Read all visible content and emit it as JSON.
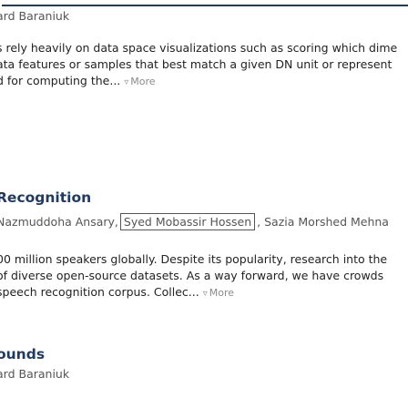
{
  "entry1": {
    "authors": "ard Baraniuk",
    "abstract_lines": [
      "s rely heavily on data space visualizations such as scoring which dime",
      "ata features or samples that best match a given DN unit or represent",
      "d for computing the..."
    ],
    "more_label": "More"
  },
  "entry2": {
    "title": "Recognition",
    "authors": [
      "Nazmuddoha Ansary,",
      "Syed Mobassir Hossen",
      ", Sazia Morshed Mehna"
    ],
    "abstract_lines": [
      "00 million speakers globally. Despite its popularity, research into the",
      "of diverse open-source datasets. As a way forward, we have crowds",
      "speech recognition corpus. Collec..."
    ],
    "more_label": "More"
  },
  "entry3": {
    "title": "ounds",
    "authors": "ard Baraniuk"
  }
}
